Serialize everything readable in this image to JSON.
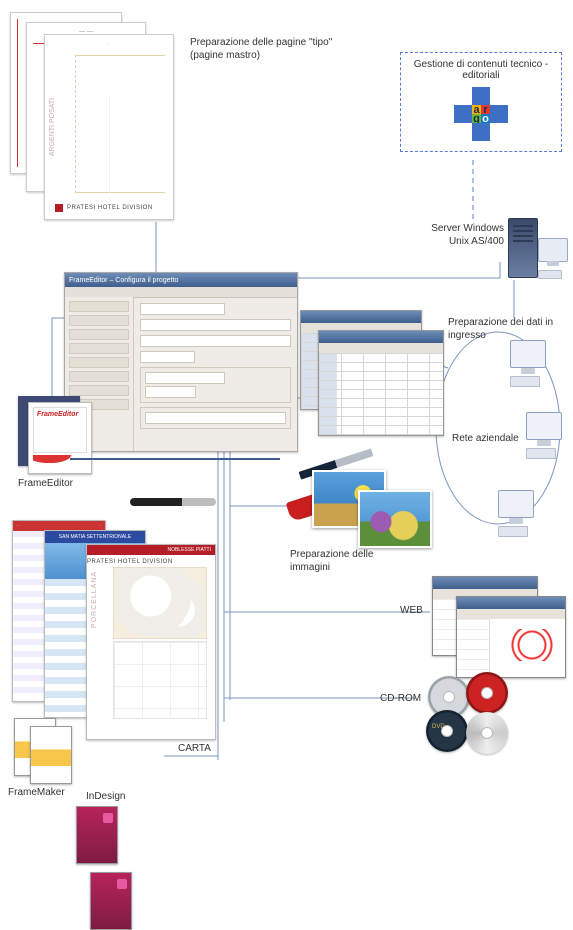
{
  "labels": {
    "master_pages": "Preparazione delle pagine \"tipo\" (pagine mastro)",
    "content_mgmt": "Gestione di contenuti tecnico - editoriali",
    "server": "Server Windows Unix AS/400",
    "frame_editor": "FrameEditor",
    "data_input": "Preparazione dei dati in ingresso",
    "network": "Rete aziendale",
    "image_prep": "Preparazione delle immagini",
    "web": "WEB",
    "cdrom": "CD-ROM",
    "carta": "CARTA",
    "framemaker": "FrameMaker",
    "indesign": "InDesign"
  },
  "master_page": {
    "footer_brand": "PRATESI HOTEL DIVISION",
    "side_text": "ARGENTI POSATI"
  },
  "frameeditor_box": {
    "title": "FrameEditor"
  },
  "app_window": {
    "title": "FrameEditor – Configura il progetto"
  },
  "catalog_doc": {
    "tab": "PORCELLANA",
    "series": "NOBLESSE PIATTI",
    "footer": "PRATESI HOTEL DIVISION"
  },
  "travel_doc": {
    "title": "SAN MATIA SETTENTRIONALE"
  },
  "argo_letters": {
    "a": "a",
    "r": "r",
    "g": "g",
    "o": "o"
  }
}
